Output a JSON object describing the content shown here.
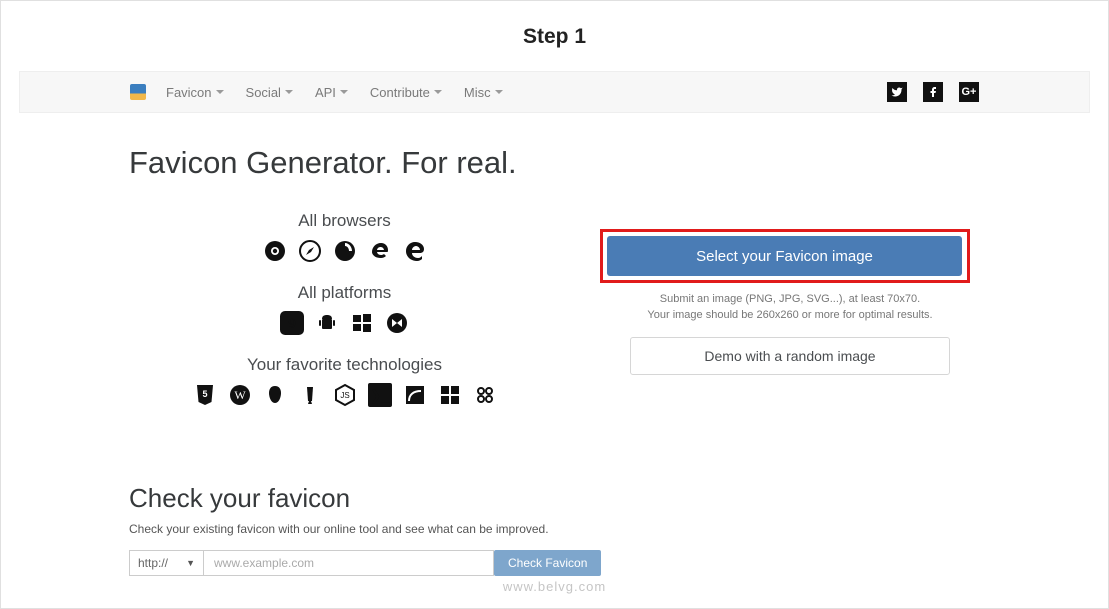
{
  "step_title": "Step 1",
  "nav": {
    "items": [
      "Favicon",
      "Social",
      "API",
      "Contribute",
      "Misc"
    ]
  },
  "hero": {
    "title": "Favicon Generator. For real.",
    "browsers_label": "All browsers",
    "platforms_label": "All platforms",
    "tech_label": "Your favorite technologies"
  },
  "upload": {
    "button": "Select your Favicon image",
    "hint1": "Submit an image (PNG, JPG, SVG...), at least 70x70.",
    "hint2": "Your image should be 260x260 or more for optimal results.",
    "demo_button": "Demo with a random image"
  },
  "check": {
    "title": "Check your favicon",
    "desc": "Check your existing favicon with our online tool and see what can be improved.",
    "protocol": "http://",
    "placeholder": "www.example.com",
    "button": "Check Favicon"
  },
  "watermark": "www.belvg.com"
}
